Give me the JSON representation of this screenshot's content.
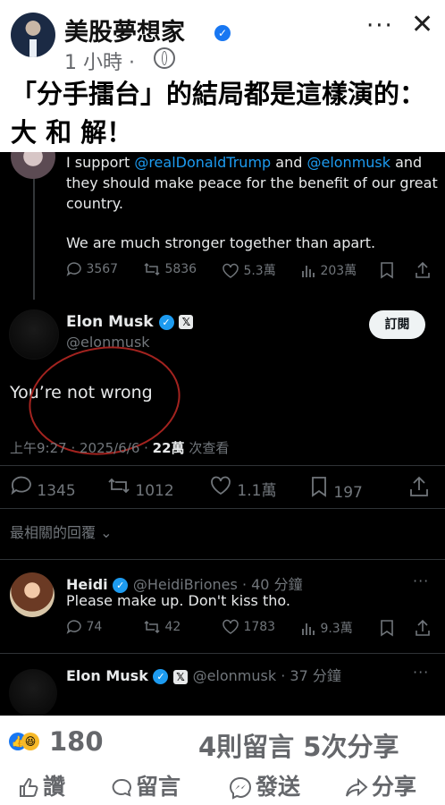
{
  "fb": {
    "author": "美股夢想家",
    "time": "1 小時 ·",
    "post_text": "「分手擂台」的結局都是這樣演的：大 和 解！",
    "reaction_count": "180",
    "comments_shares": "4則留言 5次分享",
    "actions": {
      "like": "讚",
      "comment": "留言",
      "send": "發送",
      "share": "分享"
    }
  },
  "quoted": {
    "line1_prefix": "I support ",
    "mention1": "@realDonaldTrump",
    "line1_mid": " and ",
    "mention2": "@elonmusk",
    "line1_suffix": " and they should make peace for the benefit of our great country.",
    "line2": "We are much stronger together than apart.",
    "stats": {
      "replies": "3567",
      "reposts": "5836",
      "likes": "5.3萬",
      "views": "203萬"
    }
  },
  "tweet": {
    "name": "Elon Musk",
    "handle": "@elonmusk",
    "subscribe": "訂閱",
    "text": "You’re not wrong",
    "time_date": "上午9:27 · 2025/6/6 · ",
    "views_num": "22萬",
    "views_label": " 次查看",
    "stats": {
      "replies": "1345",
      "reposts": "1012",
      "likes": "1.1萬",
      "bookmarks": "197"
    }
  },
  "replies_header": "最相關的回覆",
  "reply1": {
    "name": "Heidi",
    "handle_time": "@HeidiBriones · 40 分鐘",
    "text": "Please make up. Don't kiss tho.",
    "stats": {
      "replies": "74",
      "reposts": "42",
      "likes": "1783",
      "views": "9.3萬"
    }
  },
  "reply2": {
    "name": "Elon Musk",
    "handle_time": "@elonmusk · 37 分鐘",
    "emoji": "😂"
  }
}
